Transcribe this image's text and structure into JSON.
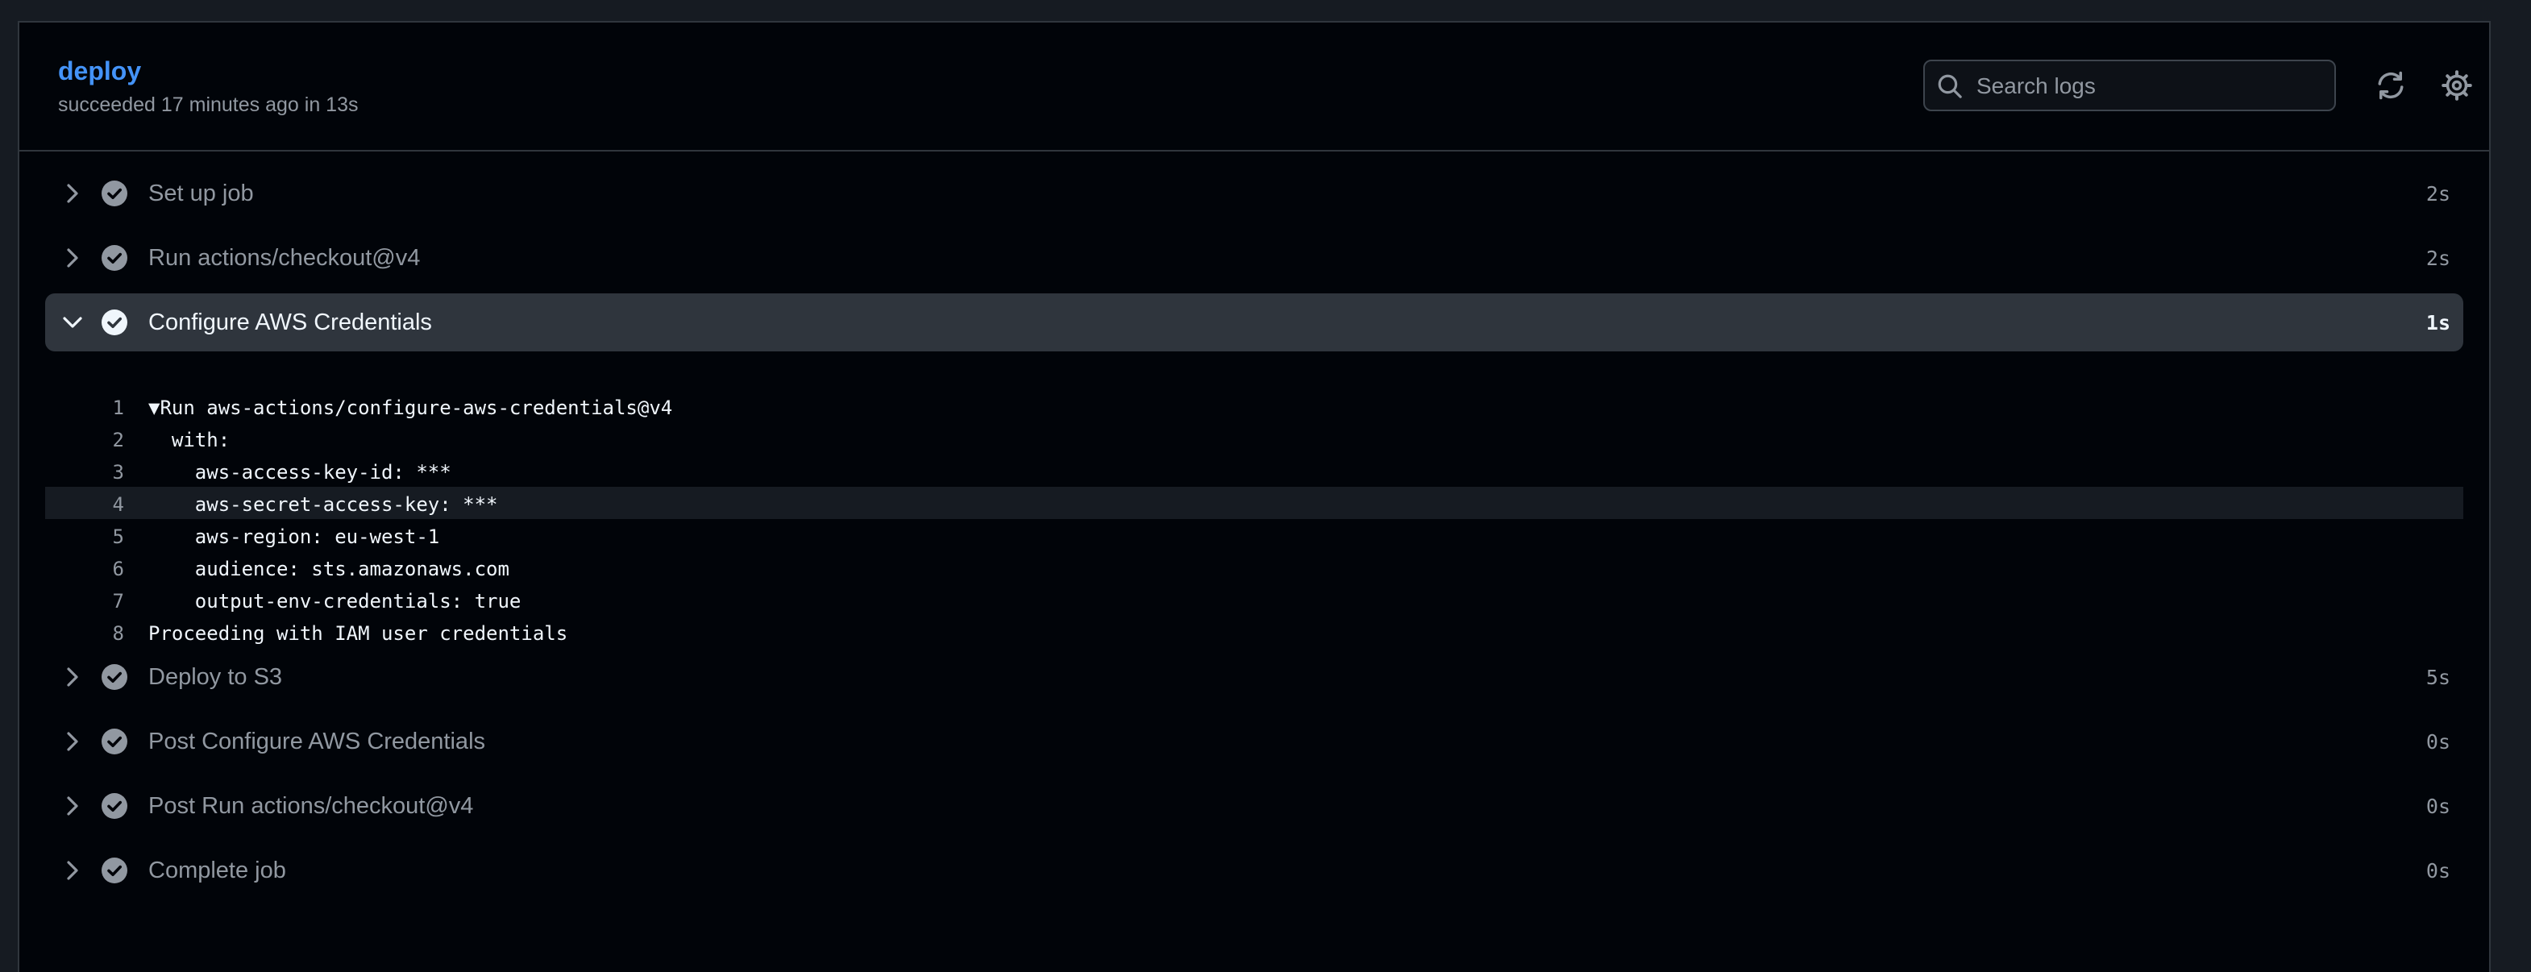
{
  "job": {
    "title": "deploy",
    "status": "succeeded 17 minutes ago in 13s"
  },
  "search": {
    "placeholder": "Search logs"
  },
  "toolbar": {
    "refresh_icon": "sync-icon",
    "settings_icon": "gear-icon"
  },
  "colors": {
    "accent": "#4493f8",
    "muted": "#9198a1",
    "background": "#010409",
    "expanded_row": "#2f353d"
  },
  "steps": [
    {
      "name": "Set up job",
      "duration": "2s",
      "expanded": false
    },
    {
      "name": "Run actions/checkout@v4",
      "duration": "2s",
      "expanded": false
    },
    {
      "name": "Configure AWS Credentials",
      "duration": "1s",
      "expanded": true
    },
    {
      "name": "Deploy to S3",
      "duration": "5s",
      "expanded": false
    },
    {
      "name": "Post Configure AWS Credentials",
      "duration": "0s",
      "expanded": false
    },
    {
      "name": "Post Run actions/checkout@v4",
      "duration": "0s",
      "expanded": false
    },
    {
      "name": "Complete job",
      "duration": "0s",
      "expanded": false
    }
  ],
  "log": [
    {
      "num": "1",
      "text": "▼Run aws-actions/configure-aws-credentials@v4"
    },
    {
      "num": "2",
      "text": "  with:"
    },
    {
      "num": "3",
      "text": "    aws-access-key-id: ***"
    },
    {
      "num": "4",
      "text": "    aws-secret-access-key: ***"
    },
    {
      "num": "5",
      "text": "    aws-region: eu-west-1"
    },
    {
      "num": "6",
      "text": "    audience: sts.amazonaws.com"
    },
    {
      "num": "7",
      "text": "    output-env-credentials: true"
    },
    {
      "num": "8",
      "text": "Proceeding with IAM user credentials"
    }
  ]
}
